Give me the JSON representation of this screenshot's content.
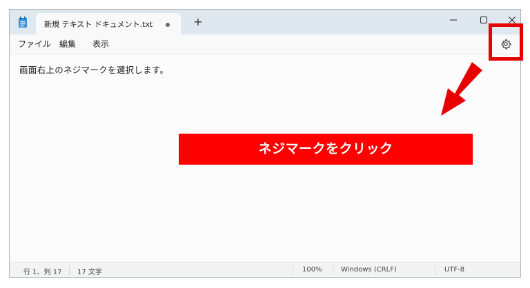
{
  "window": {
    "tab_title": "新規 テキスト ドキュメント.txt",
    "new_tab_label": "+",
    "controls": {
      "minimize": "minimize-icon",
      "maximize": "maximize-icon",
      "close": "close-icon"
    }
  },
  "menu": {
    "items": [
      "ファイル",
      "編集",
      "表示"
    ],
    "settings_icon": "gear-icon"
  },
  "editor": {
    "content": "画面右上のネジマークを選択します。"
  },
  "status": {
    "position": "行 1、列 17",
    "chars": "17 文字",
    "zoom": "100%",
    "line_ending": "Windows (CRLF)",
    "encoding": "UTF-8"
  },
  "annotation": {
    "callout": "ネジマークをクリック",
    "color": "#ff0000"
  }
}
